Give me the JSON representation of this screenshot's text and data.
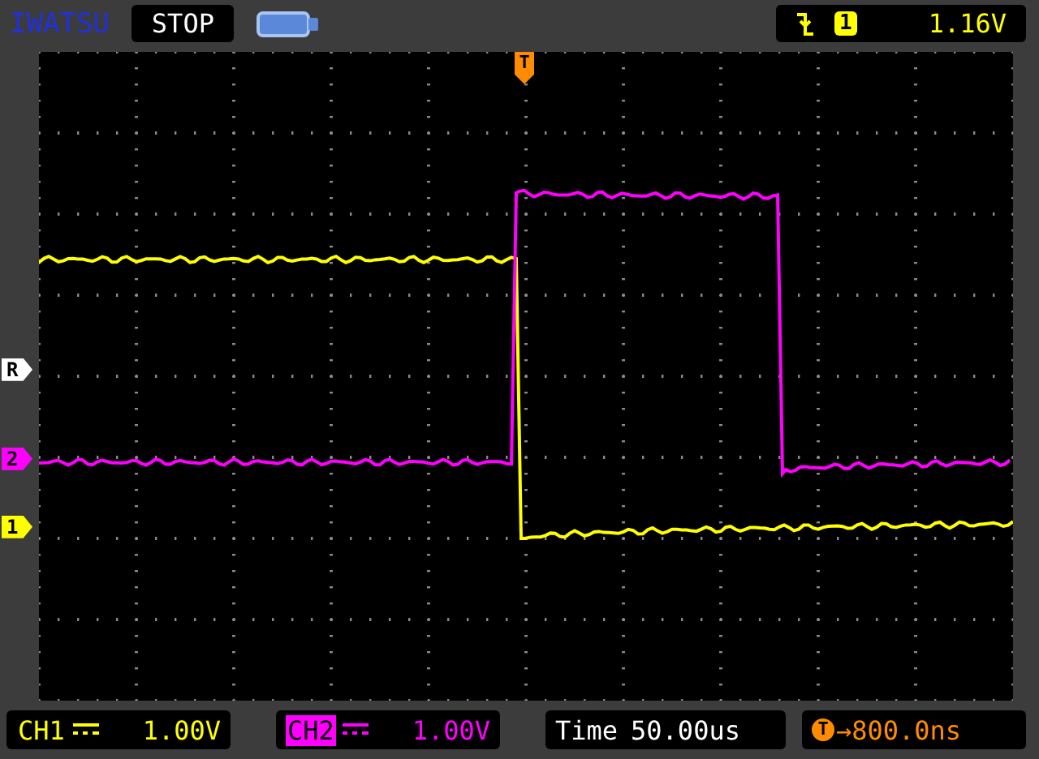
{
  "header": {
    "brand": "IWATSU",
    "run_state": "STOP",
    "trigger": {
      "channel": "1",
      "level": "1.16V"
    }
  },
  "trigger_marker": {
    "label": "T"
  },
  "markers": [
    {
      "label": "R",
      "color": "#ffffff"
    },
    {
      "label": "2",
      "color": "#ff00ff"
    },
    {
      "label": "1",
      "color": "#ffff00"
    }
  ],
  "channels": [
    {
      "label": "CH1",
      "value": "1.00V",
      "selected": false,
      "color": "#ffff00"
    },
    {
      "label": "CH2",
      "value": "1.00V",
      "selected": true,
      "color": "#ff00ff"
    }
  ],
  "timebase": {
    "label": "Time",
    "value": "50.00us"
  },
  "trigger_offset": {
    "badge": "T",
    "value": "→800.0ns"
  }
}
